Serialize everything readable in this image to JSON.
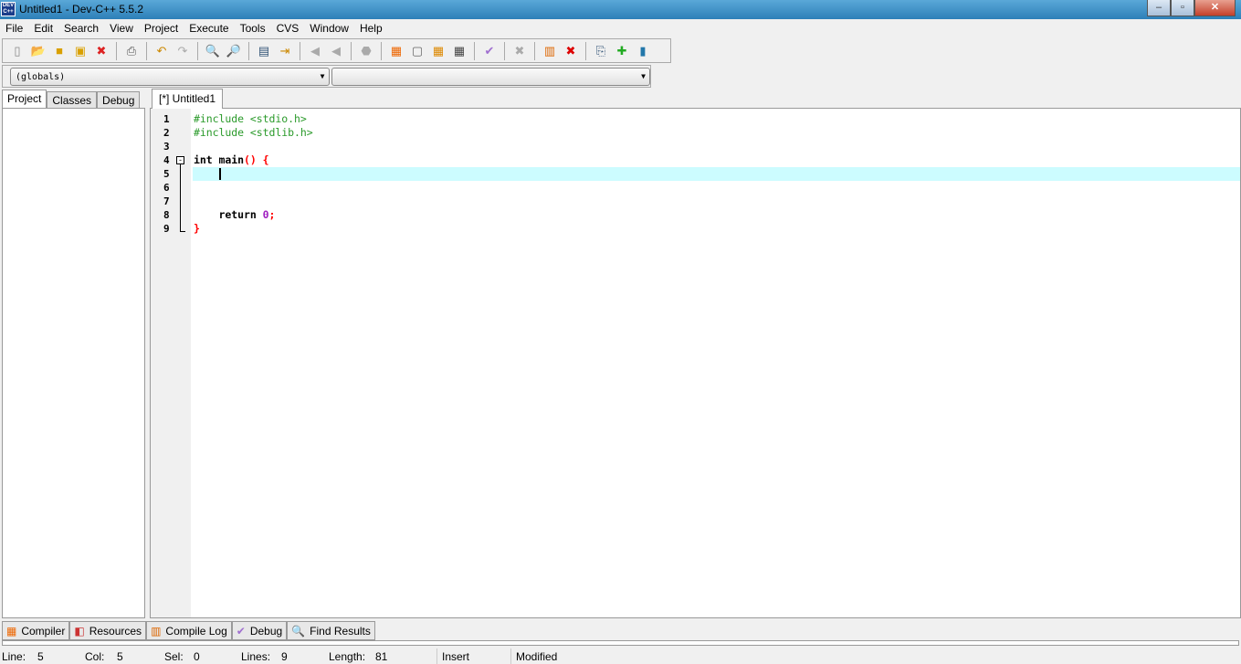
{
  "window": {
    "title": "Untitled1 - Dev-C++ 5.5.2",
    "icon": "devcpp-logo"
  },
  "menu": [
    "File",
    "Edit",
    "Search",
    "View",
    "Project",
    "Execute",
    "Tools",
    "CVS",
    "Window",
    "Help"
  ],
  "toolbar": {
    "icons": [
      "new-file",
      "open",
      "save",
      "save-all",
      "close",
      "print",
      "undo",
      "redo",
      "find",
      "replace",
      "indent",
      "unindent",
      "goto-back",
      "goto-forward",
      "bookmark",
      "compile",
      "run",
      "compile-run",
      "rebuild",
      "syntax-check",
      "stop",
      "profile",
      "delete-profile",
      "new-project",
      "add-to-project",
      "remove-from-project"
    ]
  },
  "combos": {
    "scope": "(globals)",
    "member": ""
  },
  "left_tabs": [
    "Project",
    "Classes",
    "Debug"
  ],
  "editor": {
    "tab": "[*] Untitled1",
    "line_numbers": [
      "1",
      "2",
      "3",
      "4",
      "5",
      "6",
      "7",
      "8",
      "9"
    ],
    "lines": {
      "l1": "#include <stdio.h>",
      "l2": "#include <stdlib.h>",
      "l4a": "int main",
      "l4b": "()",
      "l4c": " {",
      "l8a": "    return ",
      "l8b": "0",
      "l8c": ";",
      "l9": "}"
    },
    "current_line_color": "#ccfcff"
  },
  "bottom_tabs": [
    "Compiler",
    "Resources",
    "Compile Log",
    "Debug",
    "Find Results"
  ],
  "status": {
    "line_label": "Line:",
    "line": "5",
    "col_label": "Col:",
    "col": "5",
    "sel_label": "Sel:",
    "sel": "0",
    "lines_label": "Lines:",
    "lines": "9",
    "length_label": "Length:",
    "length": "81",
    "mode": "Insert",
    "state": "Modified"
  }
}
